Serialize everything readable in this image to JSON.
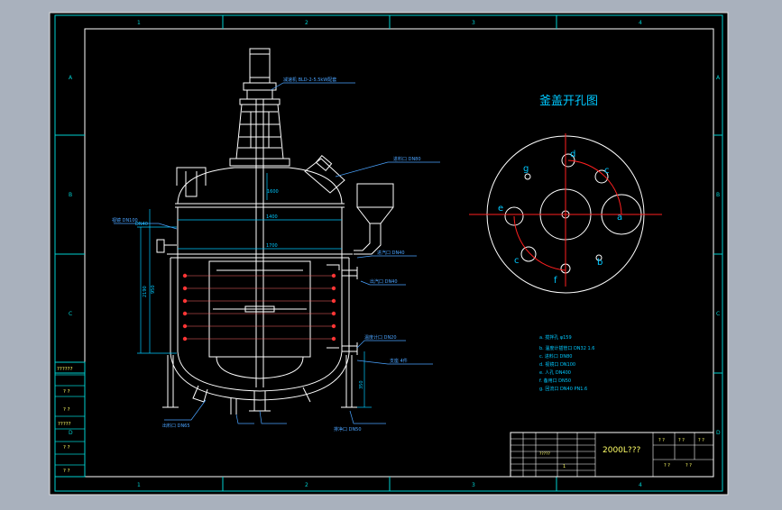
{
  "colors": {
    "background": "#a9b1bd",
    "sheet": "#000000",
    "frame": "#00d0d0",
    "structure": "#ffffff",
    "dimension": "#00c8ff",
    "leader": "#4aa3ff",
    "centerline": "#ff2020",
    "coil": "#ff3030",
    "title_text": "#ffff66"
  },
  "plate": {
    "title": "釜盖开孔图",
    "nozzle_letters": [
      "a",
      "b",
      "c",
      "d",
      "e",
      "f",
      "g"
    ]
  },
  "main_view": {
    "callouts": [
      {
        "id": "motor",
        "text": "减速机 BLD-2-5.5kW配套"
      },
      {
        "id": "feed",
        "text": "进料口 DN80"
      },
      {
        "id": "viewport",
        "text": "视镜 DN100"
      },
      {
        "id": "jacket_in",
        "text": "进汽口 DN40"
      },
      {
        "id": "jacket_out",
        "text": "出汽口 DN40"
      },
      {
        "id": "thermo",
        "text": "温度计口 DN20"
      },
      {
        "id": "support",
        "text": "支座 4件"
      },
      {
        "id": "drain",
        "text": "出料口 DN65"
      },
      {
        "id": "outlet",
        "text": "排净口 DN50"
      }
    ],
    "dimension_labels": [
      "DN40",
      "1400",
      "1700",
      "2190",
      "950",
      "350",
      "1600"
    ]
  },
  "notes": [
    "a. 搅拌孔 φ159",
    "b. 温度计插管口 DN32 1.6",
    "c. 进料口 DN80",
    "d. 视镜口 DN100",
    "e. 人孔 DN400",
    "f. 备用口 DN50",
    "g. 回流口 DN40 PN1.6"
  ],
  "zones": {
    "top": [
      "1",
      "2",
      "3",
      "4"
    ],
    "side": [
      "A",
      "B",
      "C",
      "D"
    ]
  },
  "left_block": [
    "??????",
    "? ?",
    "? ?",
    "?????",
    "? ?",
    "? ?"
  ],
  "title_block": {
    "name": "2000L???",
    "drawing_no": "?????",
    "cells": [
      "? ?",
      "? ?",
      "? ?",
      "?  ?",
      "?  ?"
    ],
    "sheet": "1"
  }
}
